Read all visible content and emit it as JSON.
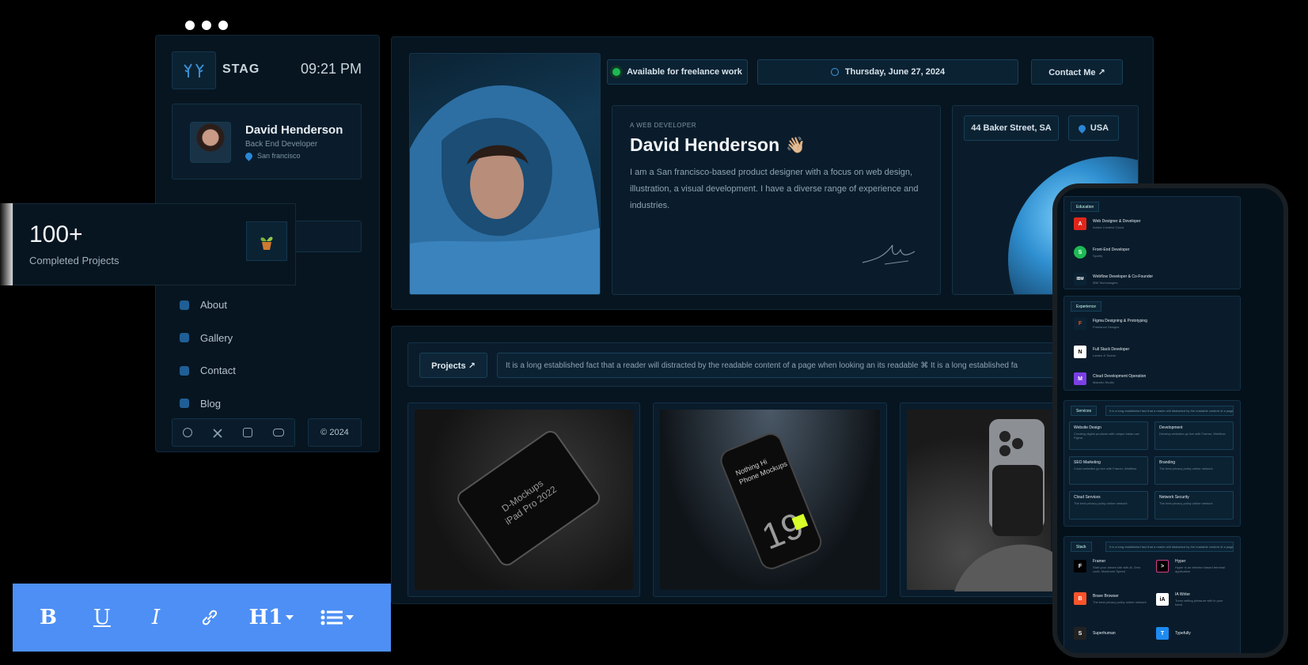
{
  "sidebar": {
    "brand": "STAG",
    "clock": "09:21 PM",
    "profile": {
      "name": "David Henderson",
      "role": "Back End Developer",
      "location": "San francisco"
    },
    "nav": [
      {
        "label": "About",
        "icon": "globe-icon"
      },
      {
        "label": "Gallery",
        "icon": "image-icon"
      },
      {
        "label": "Contact",
        "icon": "phone-icon"
      },
      {
        "label": "Blog",
        "icon": "blog-icon"
      }
    ],
    "social_icons": [
      "dribbble-icon",
      "x-icon",
      "instagram-icon",
      "youtube-icon"
    ],
    "copyright": "© 2024"
  },
  "stat": {
    "value": "100+",
    "label": "Completed Projects",
    "icon": "plant-icon"
  },
  "hero": {
    "status": "Available for freelance work",
    "date": "Thursday, June 27, 2024",
    "contact": "Contact Me ↗",
    "eyebrow": "A WEB DEVELOPER",
    "name": "David Henderson",
    "wave": "👋🏼",
    "bio": "I am a San francisco-based product designer with a focus on web design, illustration, a visual development. I have a diverse range of experience and industries.",
    "address": "44 Baker Street, SA",
    "country": "USA"
  },
  "projects": {
    "button": "Projects ↗",
    "marquee": "It is a long established fact that a reader will distracted by the readable content of a page when looking an its readable ⌘ It is a long established fa",
    "items": [
      {
        "name": "ipad-mockup",
        "caption_1": "D-Mockups",
        "caption_2": "iPad Pro 2022"
      },
      {
        "name": "iphone-mockup",
        "caption_1": "Nothing Hi",
        "caption_2": "Phone Mockups",
        "number": "19"
      },
      {
        "name": "phone-case-mockup"
      }
    ]
  },
  "phone": {
    "education": {
      "tag": "Education",
      "items": [
        {
          "title": "Web Designer & Developer",
          "sub": "Adobe Creative Cloud",
          "icon": "A",
          "color": "#e0261b"
        },
        {
          "title": "Front-End Developer",
          "sub": "Spotify",
          "icon": "S",
          "color": "#1db954"
        },
        {
          "title": "Webflow Developer & Co-Founder",
          "sub": "IBM Technologies",
          "icon": "IBM",
          "color": "#0b2233"
        }
      ]
    },
    "experience": {
      "tag": "Experience",
      "items": [
        {
          "title": "Figma Designing & Prototyping",
          "sub": "Freelance Designs",
          "icon": "F",
          "color": "#0b2233"
        },
        {
          "title": "Full Stack Developer",
          "sub": "Larsen & Toubro",
          "icon": "N",
          "color": "#ffffff"
        },
        {
          "title": "Cloud Development Operation",
          "sub": "Maestro Studio",
          "icon": "M",
          "color": "#7b3fe4"
        }
      ]
    },
    "services": {
      "tag": "Services",
      "marquee": "It is a long established fact that a reader will distracted by the readable content of a page",
      "cards": [
        {
          "title": "Website Design",
          "sub": "Creating digital products with unique ideas use Figma"
        },
        {
          "title": "Development",
          "sub": "Develop websites go live with Framer, Webflow"
        },
        {
          "title": "SEO Marketing",
          "sub": "Could websites go live with Framer, Webflow"
        },
        {
          "title": "Branding",
          "sub": "The best privacy policy online network"
        },
        {
          "title": "Cloud Services",
          "sub": "The best privacy policy online network"
        },
        {
          "title": "Network Security",
          "sub": "The best privacy policy online network"
        }
      ]
    },
    "stack": {
      "tag": "Stack",
      "marquee": "It is a long established fact that a reader will distracted by the readable content of a page",
      "items": [
        {
          "title": "Framer",
          "sub": "Start your dream site with Ai. Zero code, Maximum Speed",
          "icon": "F"
        },
        {
          "title": "Hyper",
          "sub": "Hyper is an electron based terminal application",
          "icon": ">"
        },
        {
          "title": "Brave Browser",
          "sub": "The best privacy policy online network",
          "icon": "B"
        },
        {
          "title": "IA Writer",
          "sub": "Turns writing pleasure with in your hand",
          "icon": "iA"
        },
        {
          "title": "Superhuman",
          "sub": "",
          "icon": "S"
        },
        {
          "title": "Typefully",
          "sub": "",
          "icon": "T"
        }
      ]
    }
  },
  "toolbar": {
    "bold": "B",
    "underline": "U",
    "italic": "I",
    "heading": "H1",
    "icons": [
      "bold-icon",
      "underline-icon",
      "italic-icon",
      "link-icon",
      "heading-icon",
      "list-icon"
    ]
  }
}
